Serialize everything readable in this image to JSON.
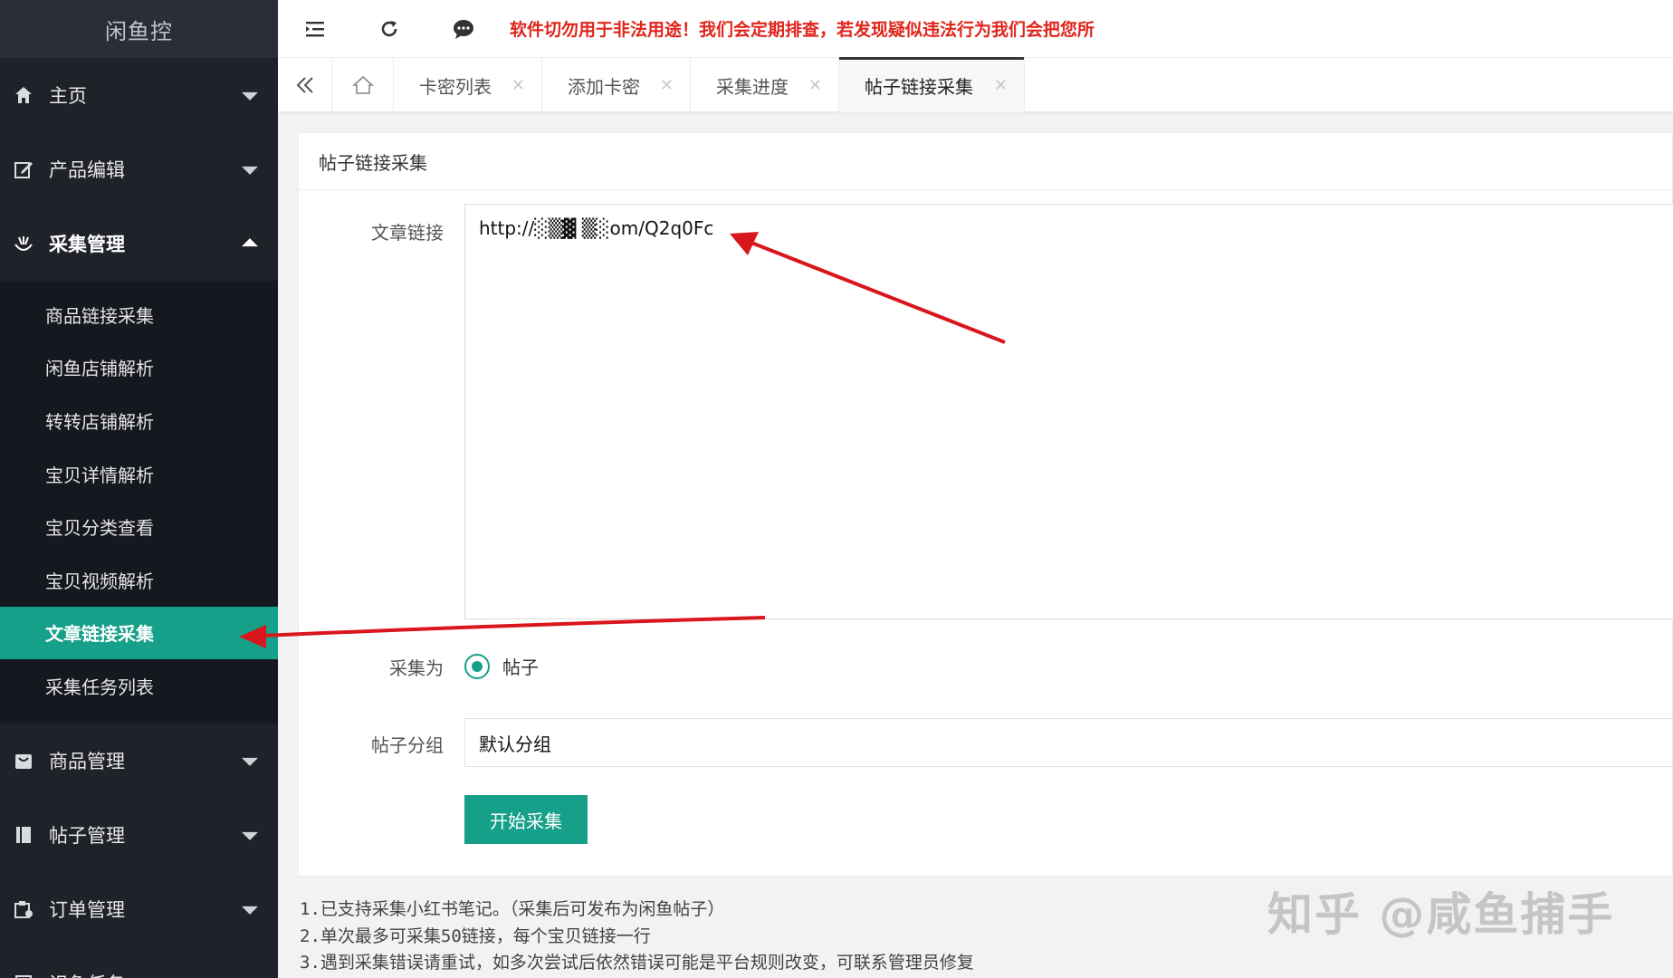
{
  "sidebar": {
    "logo": "闲鱼控",
    "menu": [
      {
        "label": "主页",
        "icon": "home-icon"
      },
      {
        "label": "产品编辑",
        "icon": "edit-icon"
      },
      {
        "label": "采集管理",
        "icon": "collect-icon",
        "open": true
      }
    ],
    "submenu": [
      {
        "label": "商品链接采集"
      },
      {
        "label": "闲鱼店铺解析"
      },
      {
        "label": "转转店铺解析"
      },
      {
        "label": "宝贝详情解析"
      },
      {
        "label": "宝贝分类查看"
      },
      {
        "label": "宝贝视频解析"
      },
      {
        "label": "文章链接采集",
        "active": true
      },
      {
        "label": "采集任务列表"
      }
    ],
    "menu_after": [
      {
        "label": "商品管理",
        "icon": "bag-icon"
      },
      {
        "label": "帖子管理",
        "icon": "book-icon"
      },
      {
        "label": "订单管理",
        "icon": "order-icon"
      },
      {
        "label": "识鱼任务",
        "icon": "task-icon"
      }
    ]
  },
  "header": {
    "notice": "软件切勿用于非法用途！我们会定期排查，若发现疑似违法行为我们会把您所"
  },
  "tabs": [
    {
      "label": "卡密列表"
    },
    {
      "label": "添加卡密"
    },
    {
      "label": "采集进度"
    },
    {
      "label": "帖子链接采集",
      "active": true
    }
  ],
  "form": {
    "title": "帖子链接采集",
    "link_label": "文章链接",
    "link_value": "http://░▒▓ ▒░om/Q2q0Fc",
    "collect_as_label": "采集为",
    "collect_as_option": "帖子",
    "group_label": "帖子分组",
    "group_value": "默认分组",
    "submit_label": "开始采集"
  },
  "notes": [
    "1.已支持采集小红书笔记。（采集后可发布为闲鱼帖子）",
    "2.单次最多可采集50链接，每个宝贝链接一行",
    "3.遇到采集错误请重试，如多次尝试后依然错误可能是平台规则改变，可联系管理员修复"
  ],
  "watermark": "知乎 @咸鱼捕手",
  "colors": {
    "sidebar_bg": "#20222a",
    "accent": "#16a089",
    "notice_red": "#e0251c",
    "arrow_red": "#d9161c"
  }
}
